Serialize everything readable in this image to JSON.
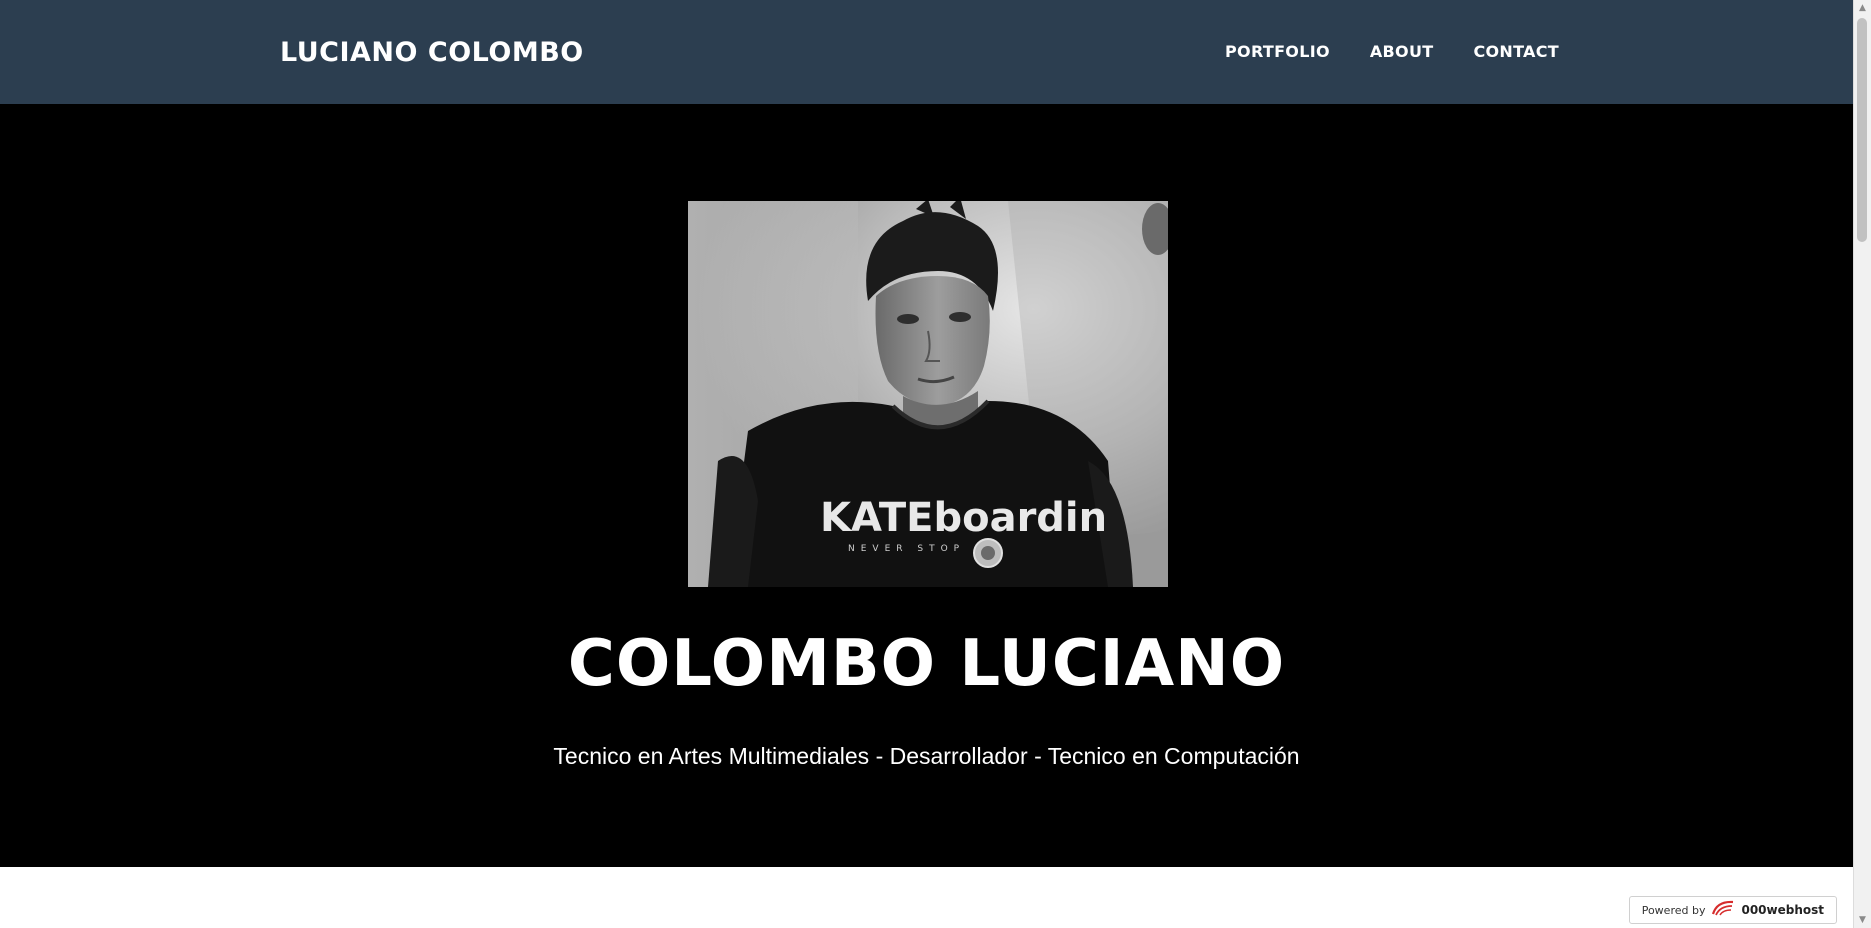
{
  "navbar": {
    "brand": "LUCIANO COLOMBO",
    "links": [
      {
        "label": "PORTFOLIO"
      },
      {
        "label": "ABOUT"
      },
      {
        "label": "CONTACT"
      }
    ],
    "background": "#2c3e50"
  },
  "hero": {
    "photo_alt": "Black and white portrait of a young man wearing a black t-shirt",
    "shirt_print": "KATEboardin",
    "shirt_print_sub": "NEVER STOP",
    "title": "COLOMBO LUCIANO",
    "subtitle": "Tecnico en Artes Multimediales - Desarrollador - Tecnico en Computación",
    "background": "#000000"
  },
  "footer_badge": {
    "prefix": "Powered by",
    "brand": "000webhost",
    "icon": "000webhost-logo-icon"
  }
}
